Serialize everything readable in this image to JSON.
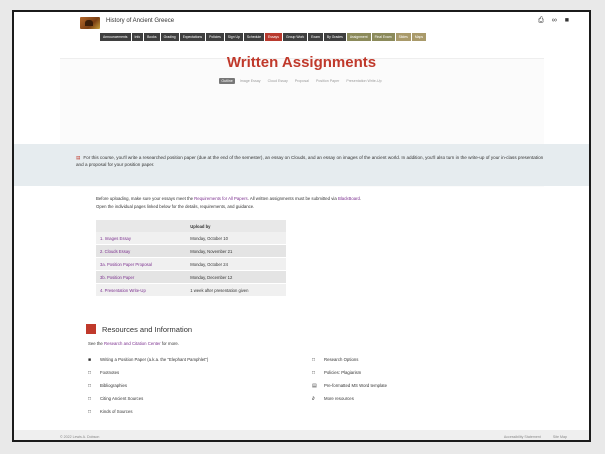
{
  "site": {
    "title": "History of Ancient Greece"
  },
  "toolbar": {
    "print_icon": "printer-icon",
    "link_icon": "link-icon",
    "menu_icon": "menu-icon"
  },
  "nav": [
    {
      "label": "Announcements",
      "style": "dark"
    },
    {
      "label": "Info",
      "style": "dark"
    },
    {
      "label": "Books",
      "style": "dark"
    },
    {
      "label": "Grading",
      "style": "dark"
    },
    {
      "label": "Expectations",
      "style": "dark"
    },
    {
      "label": "Policies",
      "style": "dark"
    },
    {
      "label": "Sign Up",
      "style": "dark"
    },
    {
      "label": "Schedule",
      "style": "dark"
    },
    {
      "label": "Essays",
      "style": "active"
    },
    {
      "label": "Group Work",
      "style": "dark"
    },
    {
      "label": "Exam",
      "style": "dark"
    },
    {
      "label": "By Grades",
      "style": "dark"
    },
    {
      "label": "Assignment",
      "style": "olive"
    },
    {
      "label": "Final Exam",
      "style": "olive"
    },
    {
      "label": "Slides",
      "style": "tan"
    },
    {
      "label": "Maps",
      "style": "tan"
    }
  ],
  "page": {
    "title": "Written Assignments",
    "subtabs": [
      "Outline",
      "Image Essay",
      "Cloud Essay",
      "Proposal",
      "Position Paper",
      "Presentation Write-Up"
    ],
    "notice": "For this course, you'll write a researched position paper (due at the end of the semester), an essay on Clouds, and an essay on images of the ancient world. In addition, you'll also turn in the write-up of your in-class presentation and a proposal for your position paper.",
    "intro_line1_pre": "Before uploading, make sure your essays meet the ",
    "intro_line1_link1": "Requirements for All Papers",
    "intro_line1_mid": ". All written assignments must be submitted via ",
    "intro_line1_link2": "BlackBoard",
    "intro_line1_end": ".",
    "intro_line2": "Open the individual pages linked below for the details, requirements, and guidance."
  },
  "assignments": {
    "header": "Upload by",
    "rows": [
      {
        "name": "1. Images Essay",
        "due": "Monday, October 10"
      },
      {
        "name": "2. Clouds Essay",
        "due": "Monday, November 21"
      },
      {
        "name": "3a. Position Paper Proposal",
        "due": "Monday, October 24"
      },
      {
        "name": "3b. Position Paper",
        "due": "Monday, December 12"
      },
      {
        "name": "4. Presentation Write-Up",
        "due": "1 week after presentation given"
      }
    ]
  },
  "resources": {
    "title": "Resources and Information",
    "sub_pre": "See the ",
    "sub_link": "Research and Citation Center",
    "sub_post": " for more.",
    "left": [
      {
        "icon": "book-icon",
        "label": "Writing a Position Paper (a.k.a. the \"Elephant Pamphlet\")"
      },
      {
        "icon": "book-open-icon",
        "label": "Footnotes"
      },
      {
        "icon": "book-open-icon",
        "label": "Bibliographies"
      },
      {
        "icon": "book-open-icon",
        "label": "Citing Ancient Sources"
      },
      {
        "icon": "book-open-icon",
        "label": "Kinds of Sources"
      }
    ],
    "right": [
      {
        "icon": "book-open-icon",
        "label": "Research Options"
      },
      {
        "icon": "book-open-icon",
        "label": "Policies: Plagiarism"
      },
      {
        "icon": "file-icon",
        "label": "Pre-formatted MS Word template"
      },
      {
        "icon": "link-icon",
        "label": "More resources"
      }
    ]
  },
  "footer": {
    "left": "© 2022 Lewis A. Dobson",
    "right1": "Accessibility Statement",
    "right2": "Site Map"
  },
  "colors": {
    "accent": "#c0392b",
    "link": "#7b2f8e",
    "nav_dark": "#3f3f3f"
  }
}
